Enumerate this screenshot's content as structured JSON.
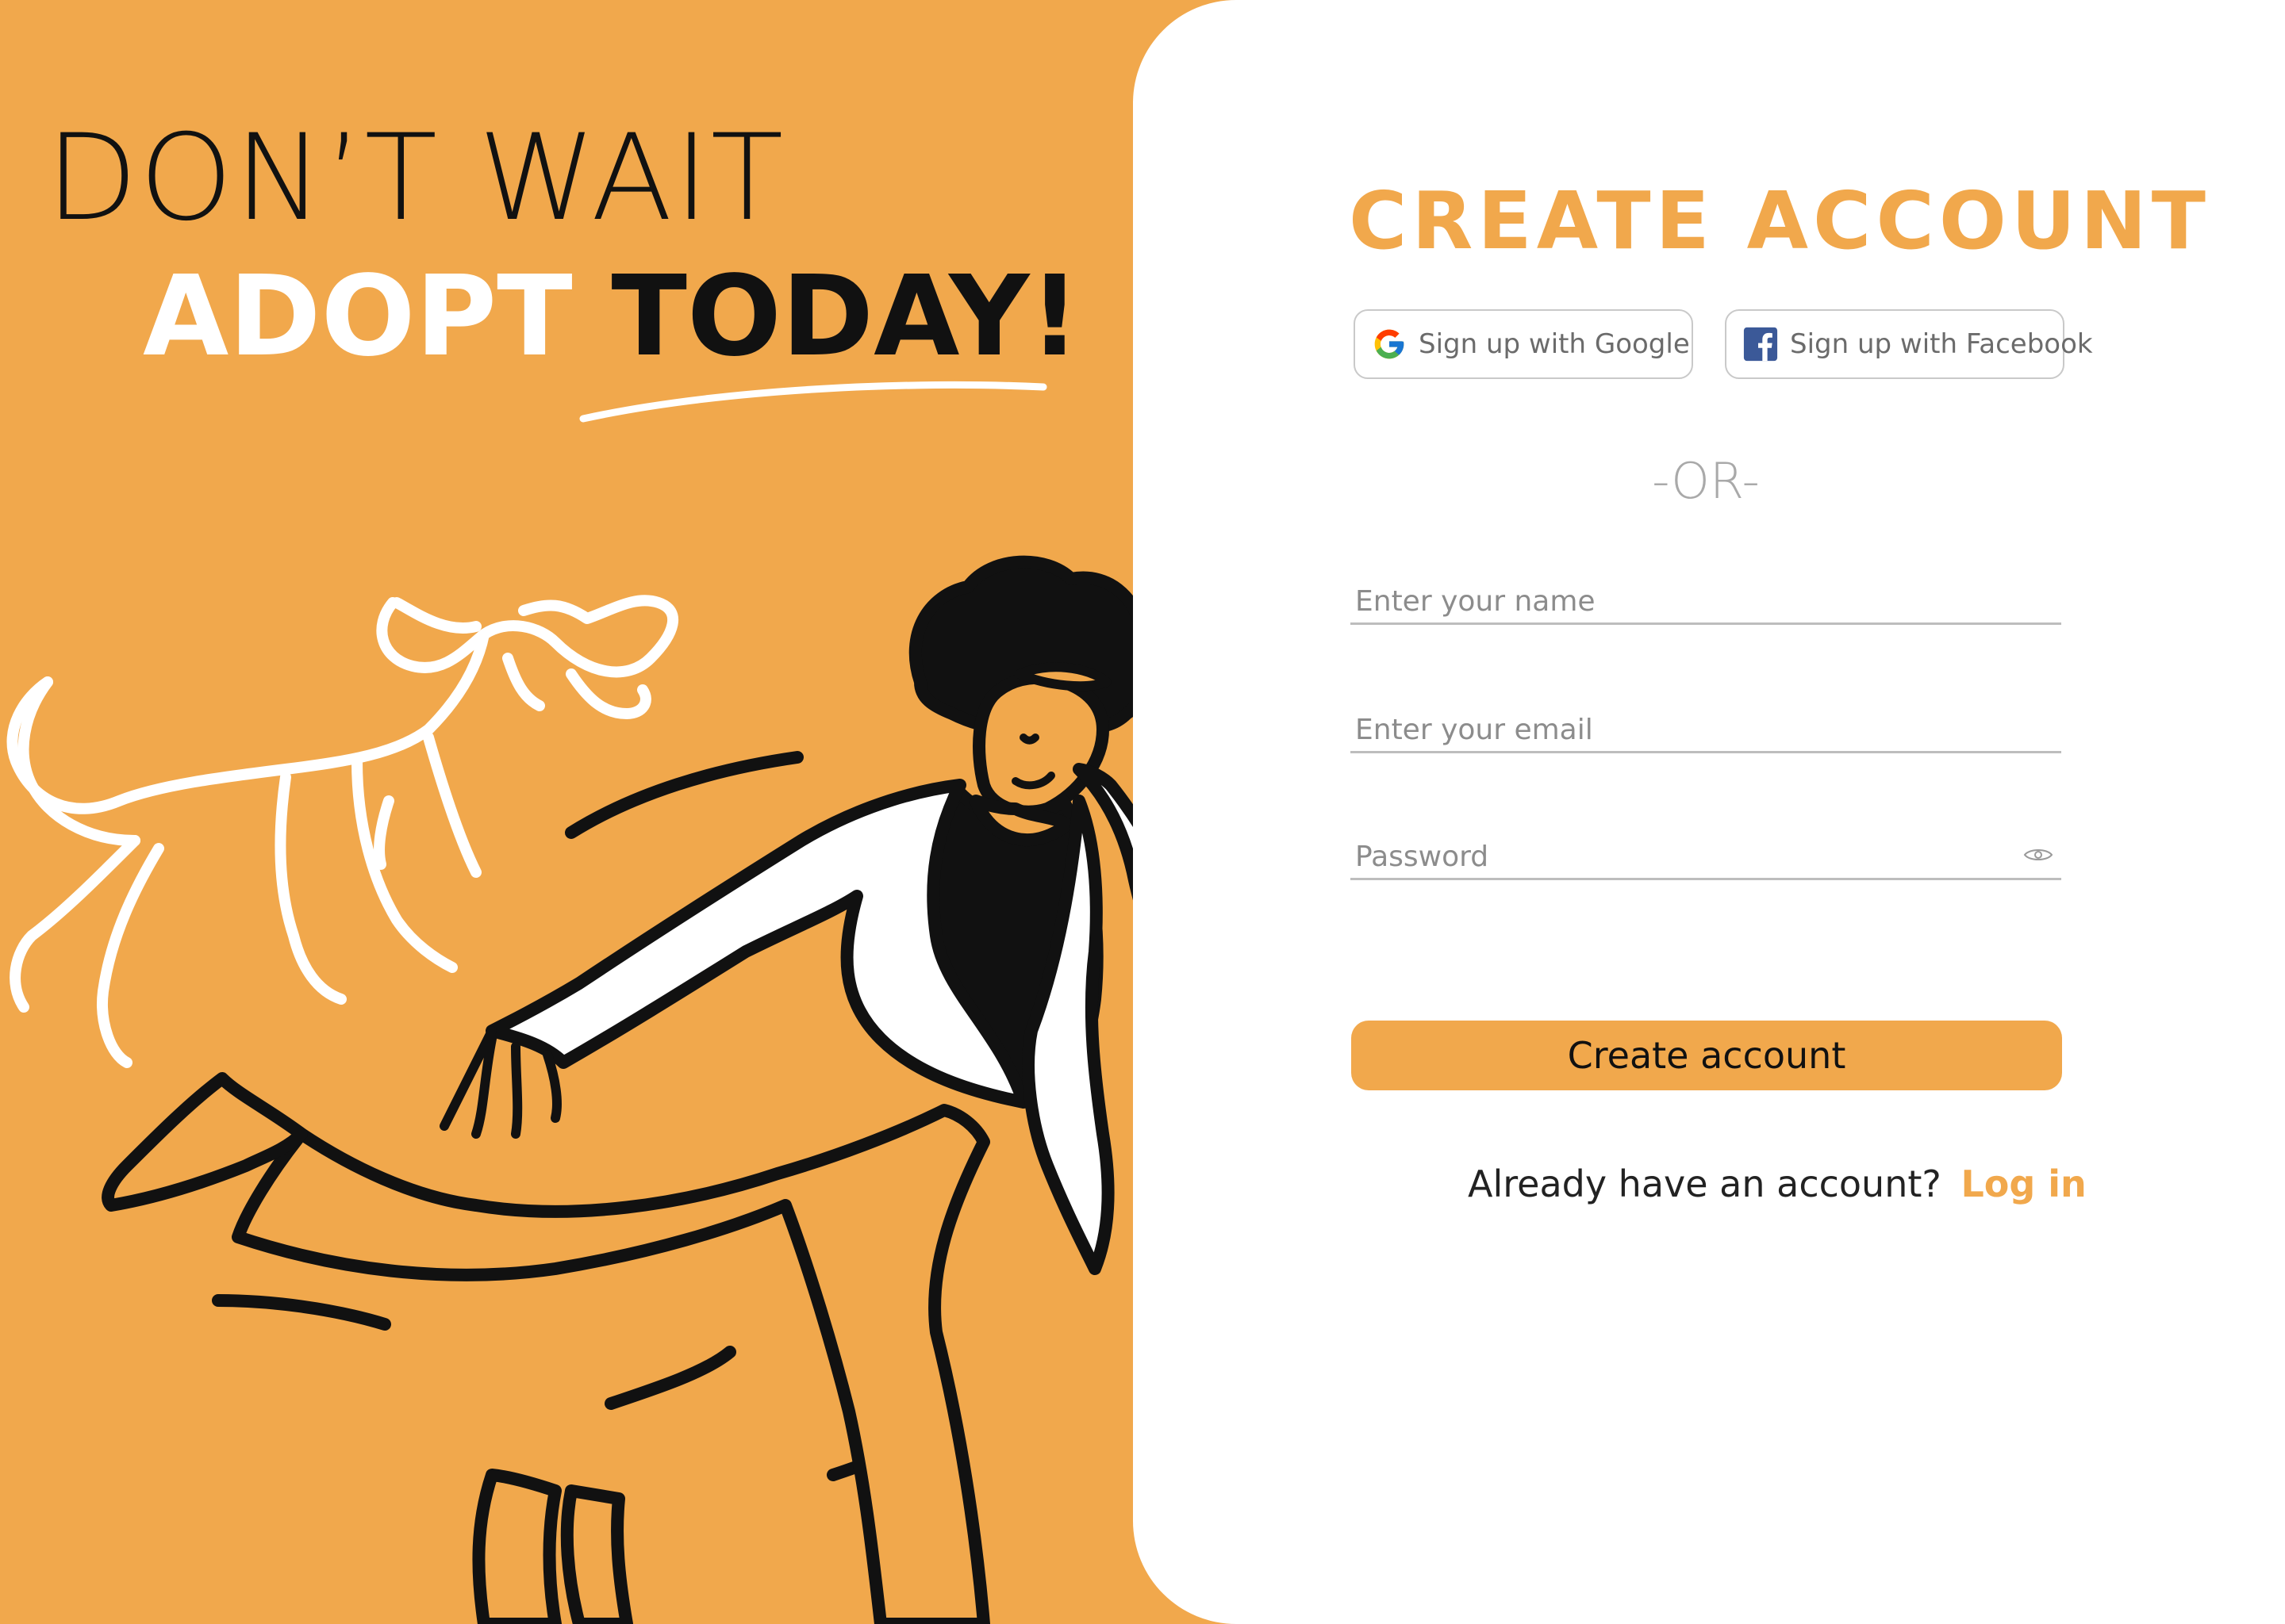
{
  "hero": {
    "line1": "DON’T WAIT",
    "line2_part1": "ADOPT",
    "line2_part2": "TODAY!"
  },
  "illustration": {
    "subjects": [
      "dog-illustration",
      "person-illustration"
    ]
  },
  "form": {
    "title": "CREATE  ACCOUNT",
    "google_label": "Sign up with Google",
    "facebook_label": "Sign up with Facebook",
    "divider": "-OR-",
    "name_placeholder": "Enter your name",
    "email_placeholder": "Enter your email",
    "password_placeholder": "Password",
    "submit_label": "Create account",
    "login_prompt": "Already have an account?",
    "login_link": "Log in"
  },
  "colors": {
    "accent": "#F1A84C",
    "background": "#F1A84C",
    "card": "#FFFFFF",
    "text_dark": "#111111",
    "facebook_blue": "#3B5998"
  },
  "icons": {
    "google": "google-icon",
    "facebook": "facebook-icon",
    "password_toggle": "eye-icon"
  }
}
